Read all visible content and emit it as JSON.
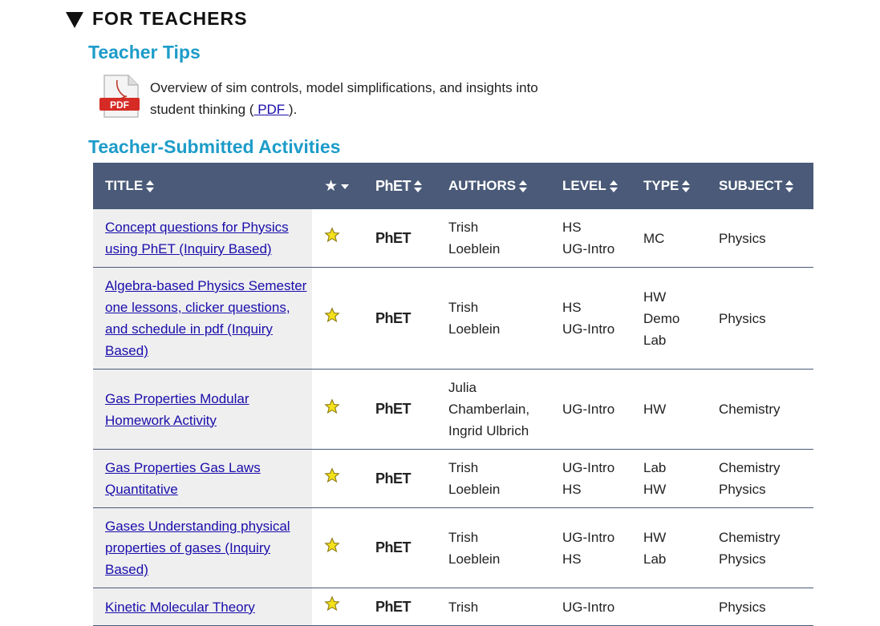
{
  "section": {
    "title": "FOR TEACHERS"
  },
  "tips": {
    "title": "Teacher Tips",
    "text": "Overview of sim controls, model simplifications, and insights into student thinking (",
    "link_label": " PDF ",
    "text_end": ").",
    "icon_label": "PDF"
  },
  "activities": {
    "title": "Teacher-Submitted Activities",
    "columns": {
      "title": "TITLE",
      "phet": "PhET",
      "authors": "AUTHORS",
      "level": "LEVEL",
      "type": "TYPE",
      "subject": "SUBJECT"
    },
    "rows": [
      {
        "title": "Concept questions for Physics using PhET (Inquiry Based)",
        "authors": [
          "Trish",
          "Loeblein"
        ],
        "level": [
          "HS",
          "UG-Intro"
        ],
        "type": [
          "MC"
        ],
        "subject": [
          "Physics"
        ]
      },
      {
        "title": "Algebra-based Physics Semester one lessons, clicker questions, and schedule in pdf (Inquiry Based)",
        "authors": [
          "Trish",
          "Loeblein"
        ],
        "level": [
          "HS",
          "UG-Intro"
        ],
        "type": [
          "HW",
          "Demo",
          "Lab"
        ],
        "subject": [
          "Physics"
        ]
      },
      {
        "title": "Gas Properties Modular Homework Activity",
        "authors": [
          "Julia",
          "Chamberlain,",
          "Ingrid Ulbrich"
        ],
        "level": [
          "UG-Intro"
        ],
        "type": [
          "HW"
        ],
        "subject": [
          "Chemistry"
        ]
      },
      {
        "title": "Gas Properties Gas Laws Quantitative",
        "authors": [
          "Trish",
          "Loeblein"
        ],
        "level": [
          "UG-Intro",
          "HS"
        ],
        "type": [
          "Lab",
          "HW"
        ],
        "subject": [
          "Chemistry",
          "Physics"
        ]
      },
      {
        "title": "Gases Understanding physical properties of gases (Inquiry Based)",
        "authors": [
          "Trish",
          "Loeblein"
        ],
        "level": [
          "UG-Intro",
          "HS"
        ],
        "type": [
          "HW",
          "Lab"
        ],
        "subject": [
          "Chemistry",
          "Physics"
        ]
      },
      {
        "title": "Kinetic Molecular Theory",
        "authors": [
          "Trish",
          ""
        ],
        "level": [
          "UG-Intro",
          ""
        ],
        "type": [
          ""
        ],
        "subject": [
          "Physics"
        ]
      }
    ]
  },
  "colors": {
    "accent": "#1d9cc9",
    "header_bg": "#4a5a78",
    "link": "#1a0dab",
    "star": "#f5e11b"
  },
  "icons": {
    "collapse": "triangle-down-icon",
    "pdf": "pdf-file-icon",
    "star": "star-icon",
    "sort": "sort-arrows-icon"
  }
}
